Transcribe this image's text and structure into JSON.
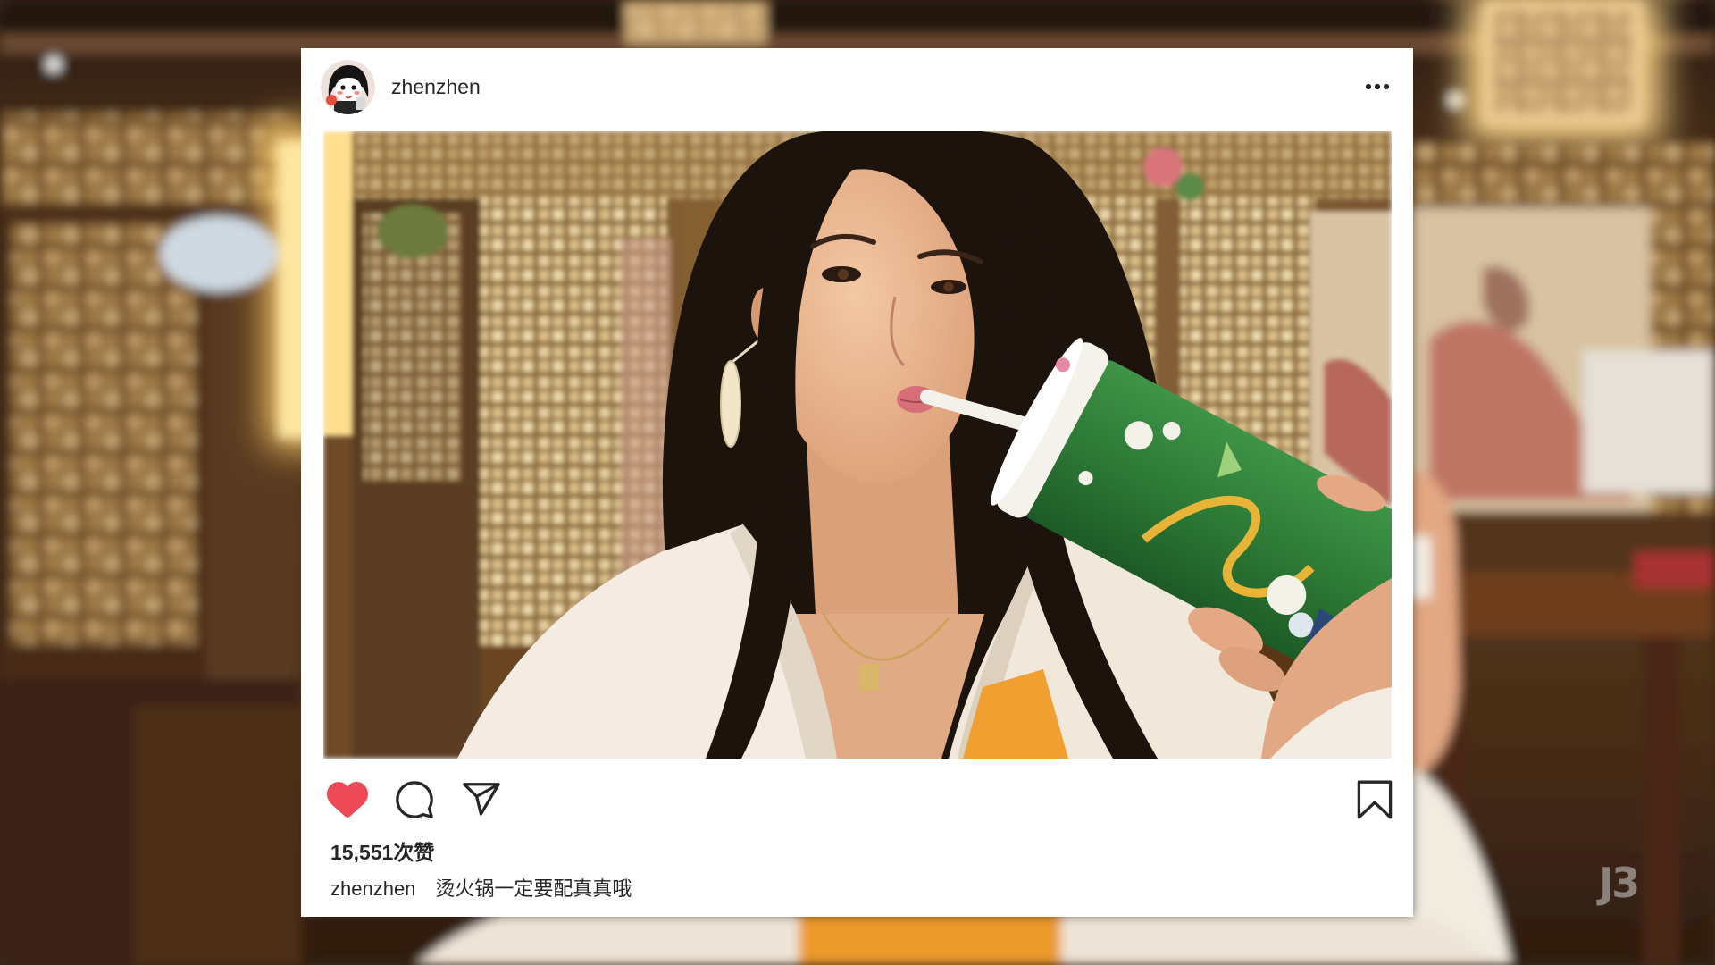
{
  "post": {
    "author": {
      "username": "zhenzhen",
      "avatar_icon": "cartoon-girl-avatar-icon"
    },
    "menu_icon": "more-horizontal-icon",
    "actions": {
      "like_icon": "heart-icon",
      "liked": true,
      "comment_icon": "comment-icon",
      "share_icon": "send-icon",
      "save_icon": "bookmark-icon"
    },
    "likes_text": "15,551次赞",
    "caption": {
      "username": "zhenzhen",
      "text": "烫火锅一定要配真真哦"
    }
  },
  "watermark": {
    "text": "J3"
  },
  "colors": {
    "card_background": "#ffffff",
    "like_red": "#ed4956",
    "icon_stroke": "#262626",
    "text": "#262626"
  }
}
